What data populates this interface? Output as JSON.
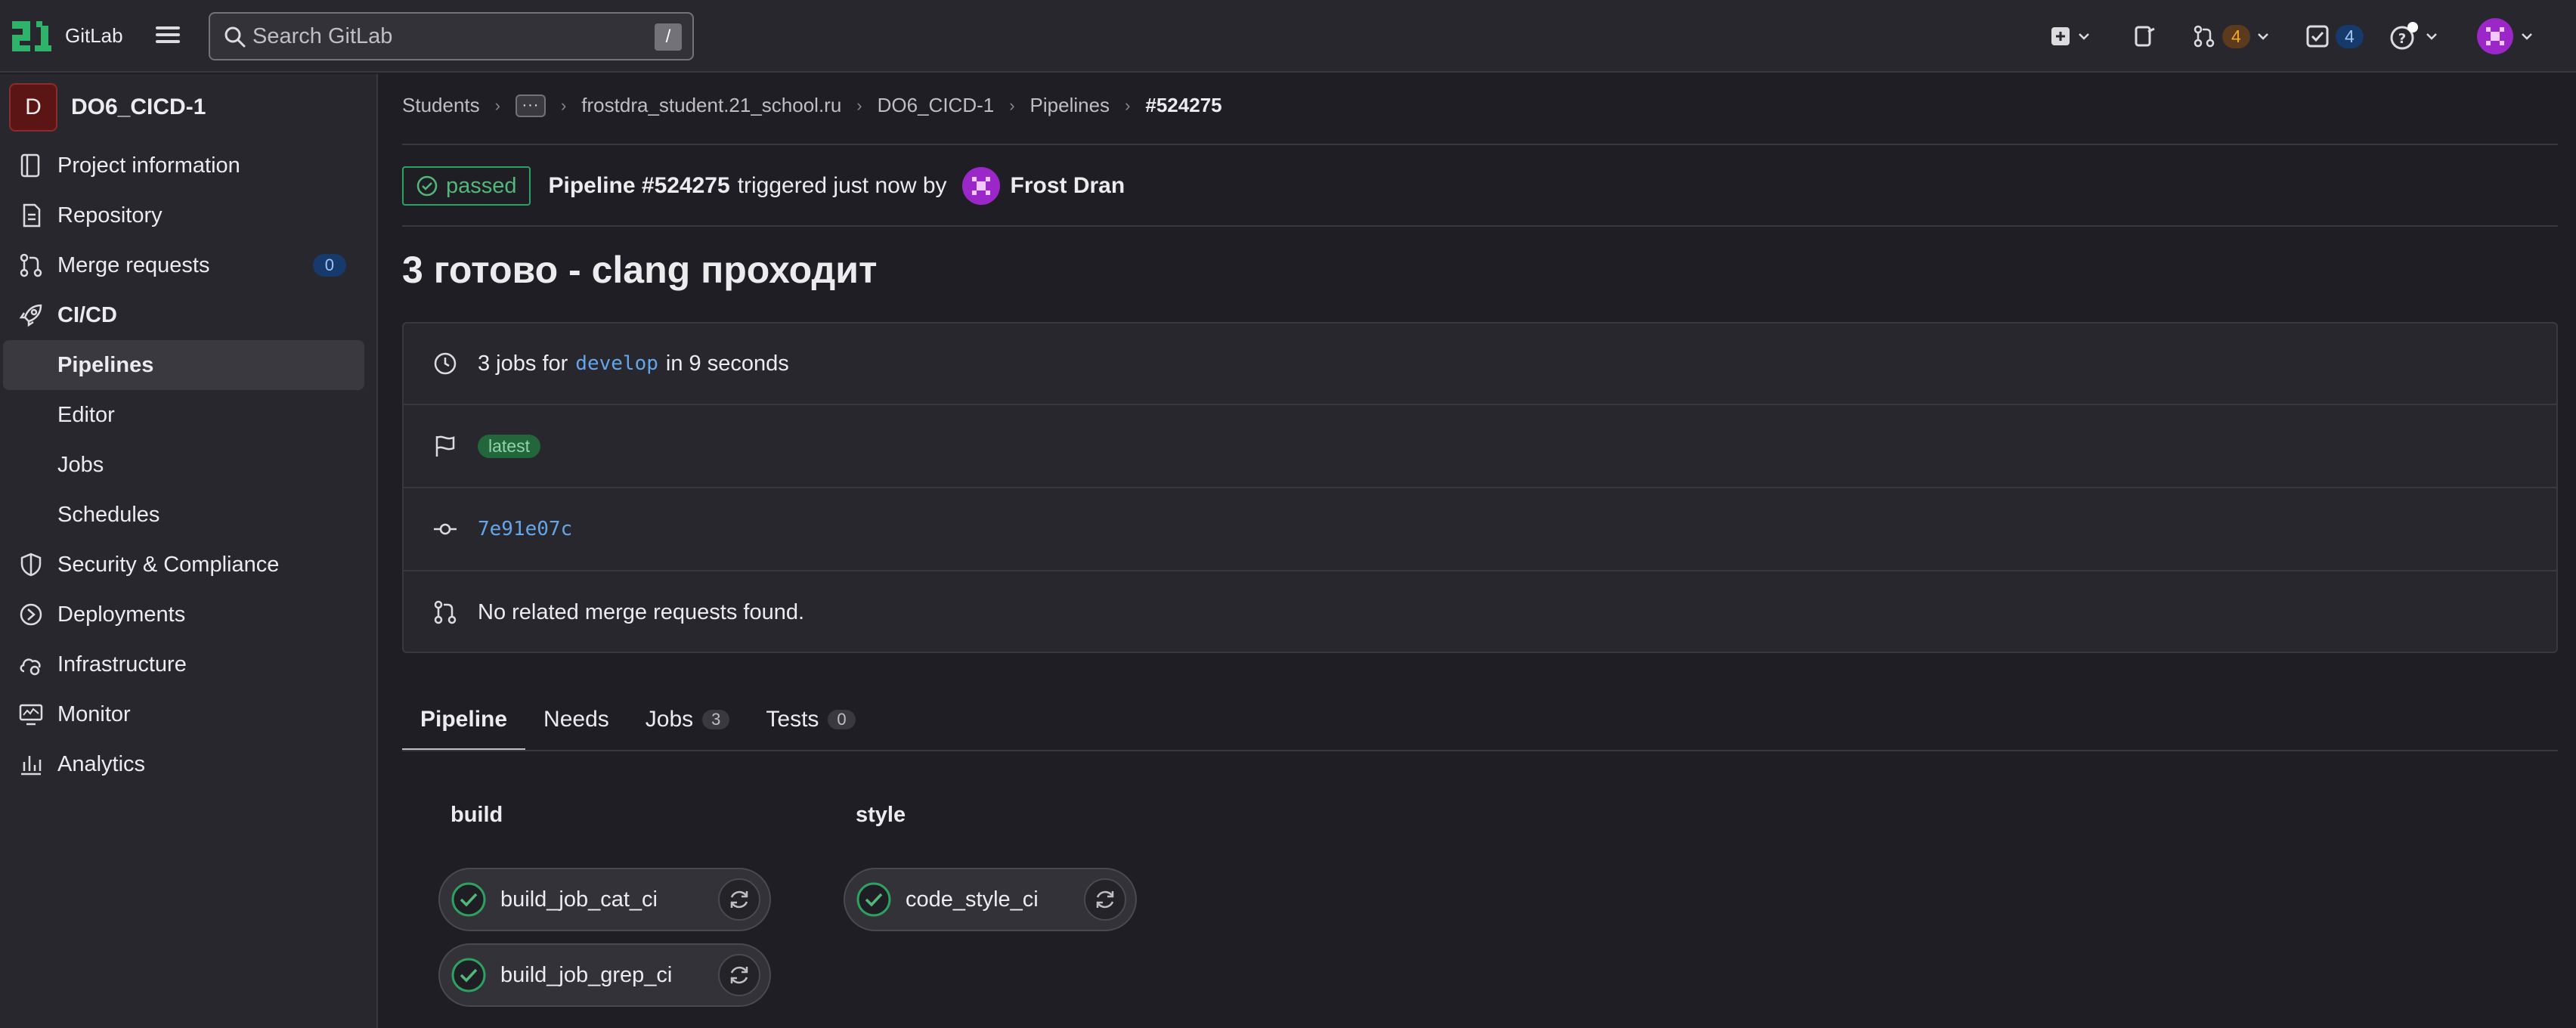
{
  "topbar": {
    "brand": "GitLab",
    "search_placeholder": "Search GitLab",
    "search_shortcut": "/",
    "merge_requests_count": "4",
    "todos_count": "4"
  },
  "sidebar": {
    "project_initial": "D",
    "project_name": "DO6_CICD-1",
    "items": [
      {
        "label": "Project information"
      },
      {
        "label": "Repository"
      },
      {
        "label": "Merge requests",
        "count": "0"
      },
      {
        "label": "CI/CD"
      },
      {
        "label": "Security & Compliance"
      },
      {
        "label": "Deployments"
      },
      {
        "label": "Infrastructure"
      },
      {
        "label": "Monitor"
      },
      {
        "label": "Analytics"
      }
    ],
    "cicd_sub": [
      {
        "label": "Pipelines"
      },
      {
        "label": "Editor"
      },
      {
        "label": "Jobs"
      },
      {
        "label": "Schedules"
      }
    ]
  },
  "breadcrumb": {
    "students": "Students",
    "dots": "···",
    "namespace": "frostdra_student.21_school.ru",
    "project": "DO6_CICD-1",
    "pipelines": "Pipelines",
    "current": "#524275"
  },
  "pipeline": {
    "status": "passed",
    "title": "Pipeline #524275",
    "triggered_text": "triggered just now by",
    "user": "Frost Dran",
    "commit_title": "3 готово - clang проходит",
    "jobs_prefix": "3 jobs for",
    "branch": "develop",
    "duration": "in 9 seconds",
    "tag": "latest",
    "sha": "7e91e07c",
    "mr_text": "No related merge requests found."
  },
  "tabs": [
    {
      "label": "Pipeline"
    },
    {
      "label": "Needs"
    },
    {
      "label": "Jobs",
      "count": "3"
    },
    {
      "label": "Tests",
      "count": "0"
    }
  ],
  "stages": [
    {
      "name": "build",
      "jobs": [
        "build_job_cat_ci",
        "build_job_grep_ci"
      ]
    },
    {
      "name": "style",
      "jobs": [
        "code_style_ci"
      ]
    }
  ],
  "colors": {
    "success": "#2da160",
    "link": "#63a6e9",
    "background": "#1f1e24"
  }
}
